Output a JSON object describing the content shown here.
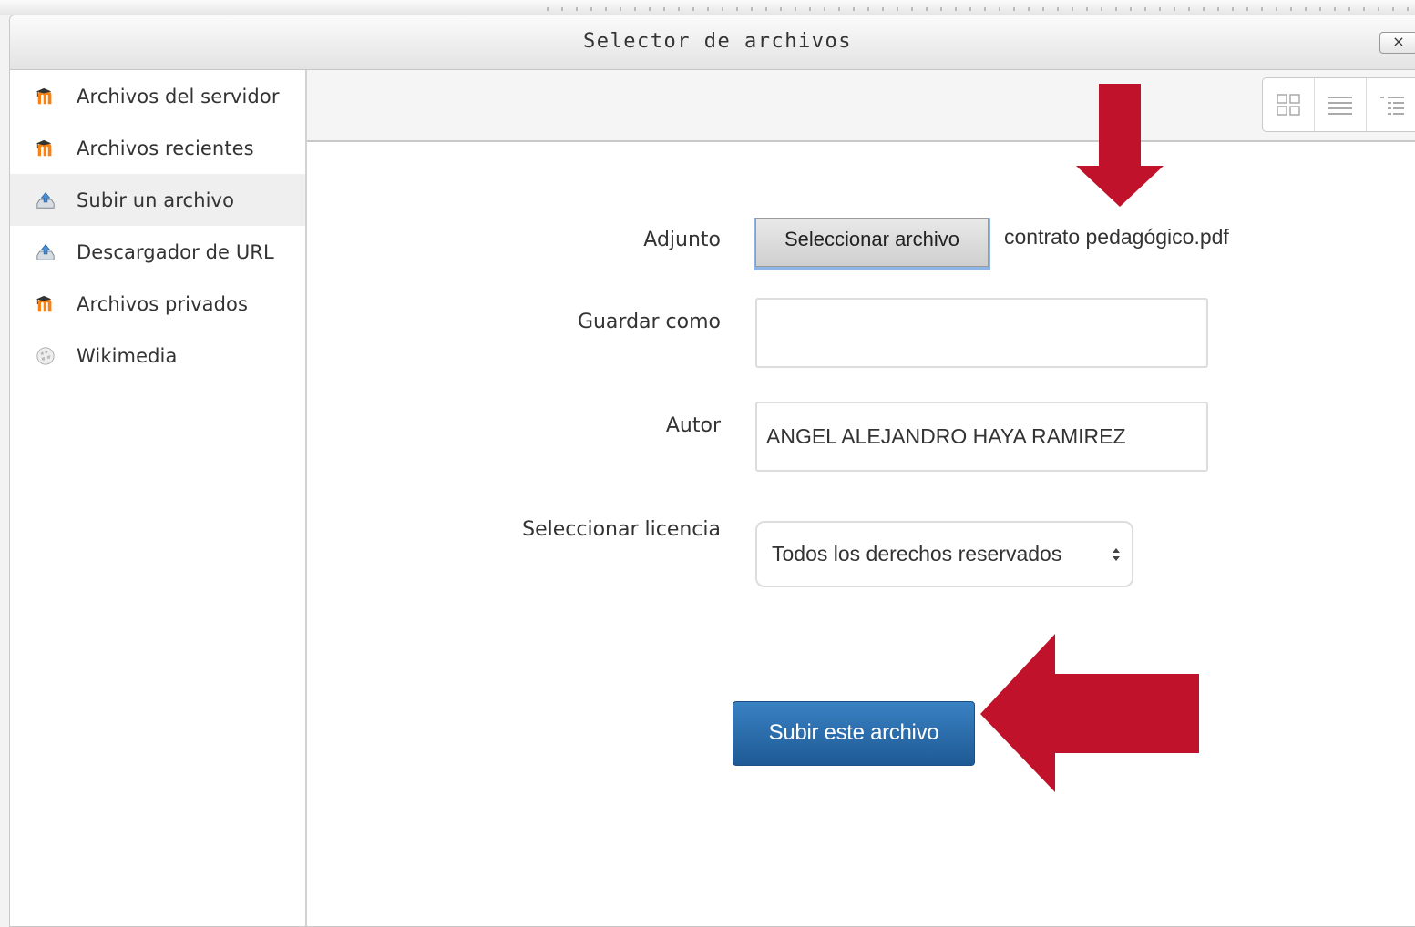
{
  "dialog": {
    "title": "Selector de archivos",
    "close_label": "×"
  },
  "sidebar": {
    "items": [
      {
        "label": "Archivos del servidor",
        "icon": "moodle-icon"
      },
      {
        "label": "Archivos recientes",
        "icon": "moodle-icon"
      },
      {
        "label": "Subir un archivo",
        "icon": "upload-icon",
        "active": true
      },
      {
        "label": "Descargador de URL",
        "icon": "upload-icon"
      },
      {
        "label": "Archivos privados",
        "icon": "moodle-icon"
      },
      {
        "label": "Wikimedia",
        "icon": "wikimedia-icon"
      }
    ]
  },
  "toolbar": {
    "views": [
      "grid-view-icon",
      "list-view-icon",
      "tree-view-icon"
    ]
  },
  "form": {
    "attachment_label": "Adjunto",
    "choose_file_label": "Seleccionar archivo",
    "file_name": "contrato pedagógico.pdf",
    "save_as_label": "Guardar como",
    "save_as_value": "",
    "author_label": "Autor",
    "author_value": "ANGEL ALEJANDRO HAYA RAMIREZ",
    "license_label": "Seleccionar licencia",
    "license_value": "Todos los derechos reservados",
    "submit_label": "Subir este archivo"
  },
  "colors": {
    "arrow": "#c0122b",
    "primary_button": "#2a6fb0",
    "moodle_orange": "#f98012"
  }
}
